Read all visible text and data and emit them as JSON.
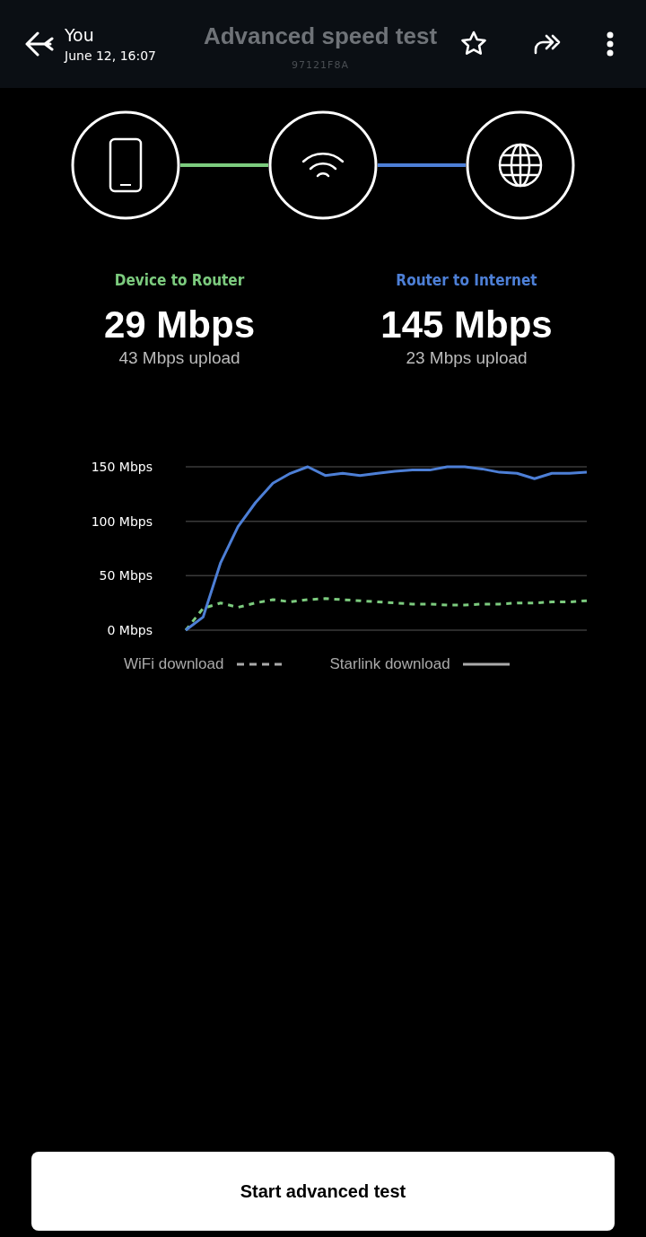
{
  "header": {
    "user": "You",
    "timestamp": "June 12, 16:07",
    "title": "Advanced speed test",
    "device_id": "97121F8A"
  },
  "path": {
    "nodes": [
      {
        "kind": "phone"
      },
      {
        "kind": "wifi"
      },
      {
        "kind": "globe"
      }
    ],
    "links": [
      {
        "color": "#7ccb7e"
      },
      {
        "color": "#4d7fd6"
      }
    ]
  },
  "stats": [
    {
      "label": "Device to Router",
      "color": "#7ccb7e",
      "download": "29 Mbps",
      "upload": "43 Mbps upload"
    },
    {
      "label": "Router to Internet",
      "color": "#4d7fd6",
      "download": "145 Mbps",
      "upload": "23 Mbps upload"
    }
  ],
  "chart": {
    "chart_data": {
      "type": "line",
      "grid": true,
      "ylim": [
        0,
        150
      ],
      "yticks": [
        {
          "value": 0,
          "label": "0 Mbps"
        },
        {
          "value": 50,
          "label": "50 Mbps"
        },
        {
          "value": 100,
          "label": "100 Mbps"
        },
        {
          "value": 150,
          "label": "150 Mbps"
        }
      ],
      "series": [
        {
          "name": "WiFi download",
          "color": "#7ccb7e",
          "line_style": "dashed",
          "values": [
            0,
            20,
            25,
            21,
            25,
            28,
            26,
            28,
            29,
            28,
            27,
            26,
            25,
            24,
            24,
            23,
            23,
            24,
            24,
            25,
            25,
            26,
            26,
            27
          ]
        },
        {
          "name": "Starlink download",
          "color": "#4d7fd6",
          "line_style": "solid",
          "values": [
            0,
            12,
            62,
            95,
            117,
            135,
            144,
            150,
            142,
            144,
            142,
            144,
            146,
            147,
            147,
            150,
            150,
            148,
            145,
            144,
            139,
            144,
            144,
            145
          ]
        }
      ]
    }
  },
  "start_button": "Start advanced test"
}
